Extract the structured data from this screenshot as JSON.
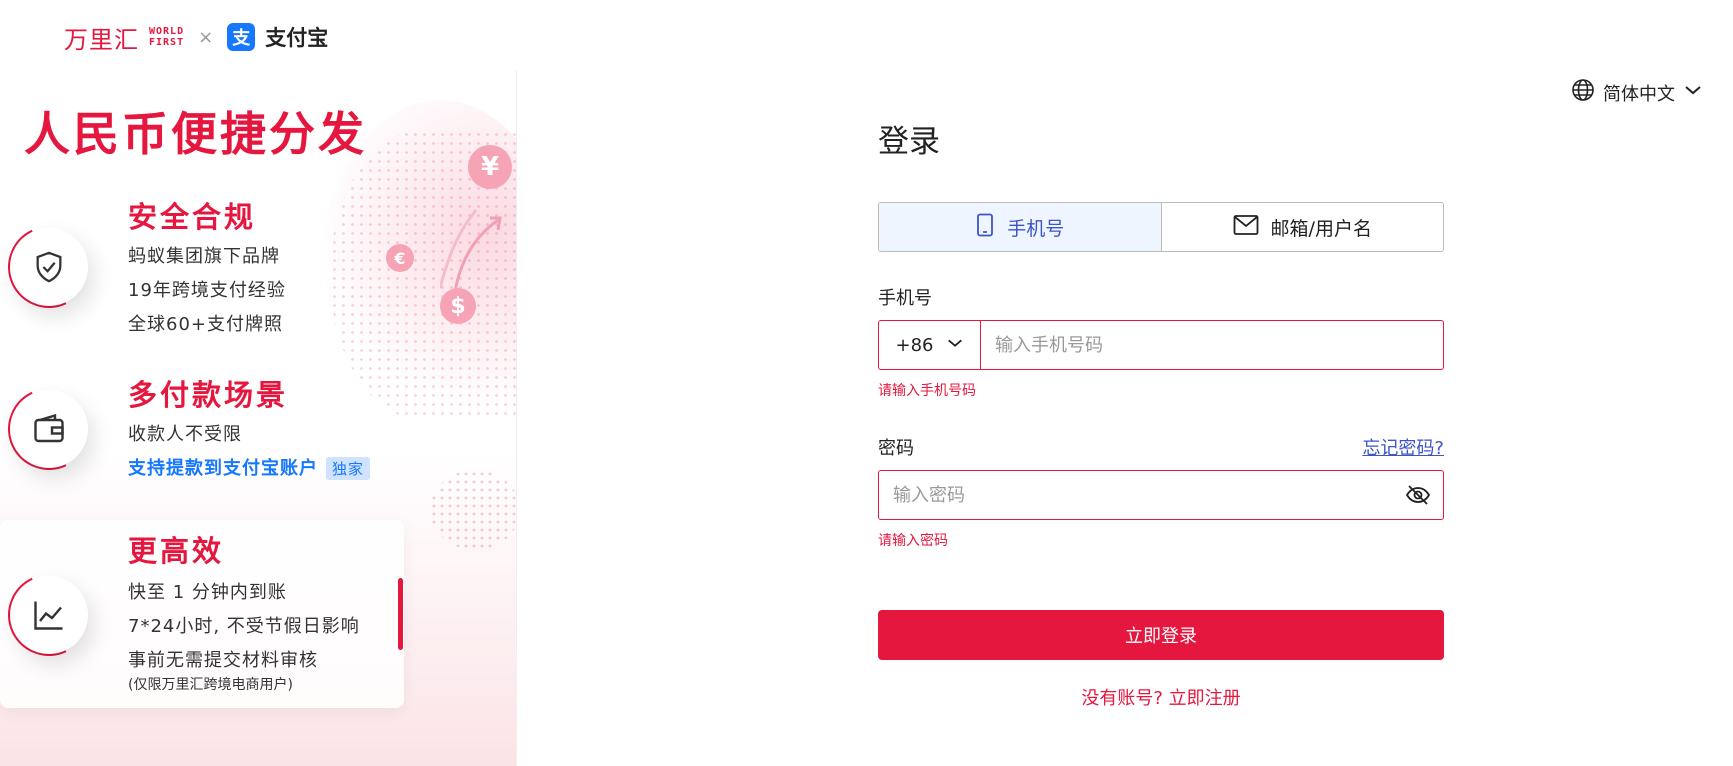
{
  "brand": {
    "worldfirst_cn": "万里汇",
    "worldfirst_en_line1": "WORLD",
    "worldfirst_en_line2": "FIRST",
    "separator": "×",
    "alipay_glyph": "支",
    "alipay_name": "支付宝"
  },
  "language": {
    "label": "简体中文",
    "icon": "globe-icon"
  },
  "promo": {
    "title": "人民币便捷分发",
    "features": [
      {
        "title": "安全合规",
        "icon": "shield-check-icon",
        "lines": [
          "蚂蚁集团旗下品牌",
          "19年跨境支付经验",
          "全球60+支付牌照"
        ]
      },
      {
        "title": "多付款场景",
        "icon": "wallet-icon",
        "lines": [
          "收款人不受限"
        ],
        "highlight": "支持提款到支付宝账户",
        "badge": "独家"
      },
      {
        "title": "更高效",
        "icon": "chart-line-icon",
        "lines": [
          "快至 1 分钟内到账",
          "7*24小时, 不受节假日影响",
          "事前无需提交材料审核"
        ],
        "note": "(仅限万里汇跨境电商用户)"
      }
    ],
    "coins": {
      "yen": "¥",
      "euro": "€",
      "dollar": "$"
    }
  },
  "login": {
    "title": "登录",
    "tabs": [
      {
        "label": "手机号",
        "icon": "mobile-phone-icon",
        "active": true
      },
      {
        "label": "邮箱/用户名",
        "icon": "mail-icon",
        "active": false
      }
    ],
    "phone": {
      "label": "手机号",
      "country_code": "+86",
      "value": "",
      "placeholder": "输入手机号码",
      "error": "请输入手机号码"
    },
    "password": {
      "label": "密码",
      "forgot": "忘记密码?",
      "value": "",
      "placeholder": "输入密码",
      "error": "请输入密码"
    },
    "submit_label": "立即登录",
    "signup_text": "没有账号? 立即注册"
  },
  "colors": {
    "brand_red": "#e5173f",
    "active_blue": "#3d53c8",
    "alipay_blue": "#1677ff"
  }
}
